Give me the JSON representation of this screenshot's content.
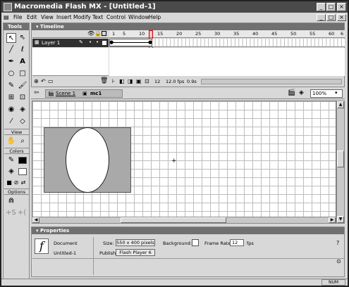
{
  "window": {
    "title": "Macromedia Flash MX - [Untitled-1]"
  },
  "menu": [
    "File",
    "Edit",
    "View",
    "Insert",
    "Modify",
    "Text",
    "Control",
    "Window",
    "Help"
  ],
  "tools": {
    "header": "Tools",
    "view_label": "View",
    "colors_label": "Colors",
    "options_label": "Options"
  },
  "timeline": {
    "header": "Timeline",
    "layer_name": "Layer 1",
    "frame_numbers": [
      "1",
      "5",
      "10",
      "15",
      "20",
      "25",
      "30",
      "35",
      "40",
      "45",
      "50",
      "55",
      "60",
      "6"
    ],
    "current_frame": "12",
    "frame_rate": "12.0 fps",
    "elapsed": "0.9s"
  },
  "editbar": {
    "scene": "Scene 1",
    "symbol": "mc1",
    "zoom": "100%"
  },
  "properties": {
    "header": "Properties",
    "doc_type": "Document",
    "doc_name": "Untitled-1",
    "size_label": "Size:",
    "size_value": "550 x 400 pixels",
    "background_label": "Background:",
    "frame_rate_label": "Frame Rate:",
    "frame_rate_value": "12",
    "fps_label": "fps",
    "publish_label": "Publish:",
    "publish_value": "Flash Player 6"
  },
  "status": {
    "num": "NUM"
  },
  "colors": {
    "stage_rect": "#a9a9a9",
    "chrome": "#d8d8d8",
    "header": "#707070"
  }
}
